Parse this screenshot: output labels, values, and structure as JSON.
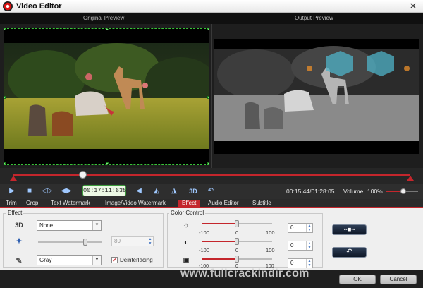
{
  "window": {
    "title": "Video Editor",
    "close_glyph": "✕"
  },
  "preview": {
    "original_label": "Original Preview",
    "output_label": "Output Preview"
  },
  "playback": {
    "timecode": "00:17:11:635",
    "time_readout": "00:15:44/01:28:05",
    "volume_label": "Volume:",
    "volume_value": "100%",
    "volume_level": 1.0,
    "position_fraction": 0.175,
    "buttons": [
      "play-icon",
      "stop-icon",
      "prev-frame-icon",
      "next-frame-icon",
      "flip-horizontal-icon",
      "flip-vertical-icon",
      "rotate-icon",
      "3d-icon",
      "undo-icon"
    ],
    "label_3d": "3D"
  },
  "tabs": [
    {
      "label": "Trim",
      "active": false
    },
    {
      "label": "Crop",
      "active": false
    },
    {
      "label": "Text Watermark",
      "active": false
    },
    {
      "label": "Image/Video Watermark",
      "active": false
    },
    {
      "label": "Effect",
      "active": true
    },
    {
      "label": "Audio Editor",
      "active": false
    },
    {
      "label": "Subtitle",
      "active": false
    }
  ],
  "effect": {
    "legend": "Effect",
    "icon_3d": "3D",
    "three_d_value": "None",
    "intensity_value": "80",
    "filter_value": "Gray",
    "deinterlacing_label": "Deinterlacing",
    "deinterlacing_checked": true,
    "check_glyph": "✔"
  },
  "color_control": {
    "legend": "Color Control",
    "rows": [
      {
        "name": "brightness",
        "min": "-100",
        "mid": "0",
        "max": "100",
        "value": "0"
      },
      {
        "name": "contrast",
        "min": "-100",
        "mid": "0",
        "max": "100",
        "value": "0"
      },
      {
        "name": "saturation",
        "min": "-100",
        "mid": "0",
        "max": "100",
        "value": "0"
      }
    ]
  },
  "side_buttons": {
    "apply_glyph": "▪▪◼▪▪",
    "reset_glyph": "↶"
  },
  "footer": {
    "watermark": "www.fullcrackindir.com",
    "ok_label": "OK",
    "cancel_label": "Cancel"
  },
  "colors": {
    "accent": "#c4262c",
    "selection": "#39c339",
    "output_overlay": "#4fb3c8"
  }
}
